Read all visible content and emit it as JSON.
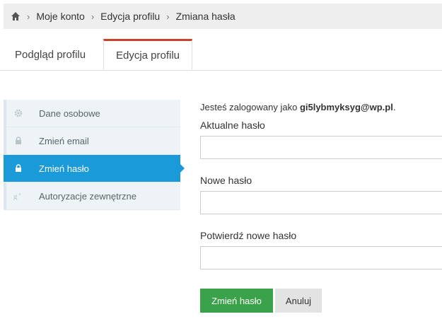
{
  "breadcrumb": {
    "home_icon": "home-icon",
    "separator": "›",
    "items": [
      "Moje konto",
      "Edycja profilu",
      "Zmiana hasła"
    ]
  },
  "tabs": [
    {
      "label": "Podgląd profilu",
      "active": false
    },
    {
      "label": "Edycja profilu",
      "active": true
    }
  ],
  "sidebar": {
    "items": [
      {
        "label": "Dane osobowe",
        "icon": "gear-icon",
        "active": false
      },
      {
        "label": "Zmień email",
        "icon": "lock-icon",
        "active": false
      },
      {
        "label": "Zmień hasło",
        "icon": "lock-icon",
        "active": true
      },
      {
        "label": "Autoryzacje zewnętrzne",
        "icon": "google-plus-icon",
        "active": false
      }
    ]
  },
  "form": {
    "logged_prefix": "Jesteś zalogowany jako",
    "email": "gi5lybmyksyg@wp.pl",
    "logged_suffix": ".",
    "current_password_label": "Aktualne hasło",
    "current_password_value": "",
    "new_password_label": "Nowe hasło",
    "new_password_value": "",
    "confirm_password_label": "Potwierdź nowe hasło",
    "confirm_password_value": "",
    "submit_label": "Zmień hasło",
    "cancel_label": "Anuluj"
  },
  "colors": {
    "accent": "#1a9ad9",
    "tab_active_border": "#c9422c",
    "submit_button": "#3aa24a"
  }
}
